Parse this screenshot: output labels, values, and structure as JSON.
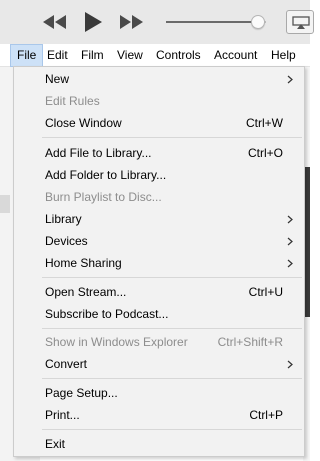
{
  "player": {
    "icons": [
      "rewind-icon",
      "play-icon",
      "fast-forward-icon",
      "airplay-icon"
    ],
    "volume_level": 0.92
  },
  "menubar": {
    "items": [
      "File",
      "Edit",
      "Film",
      "View",
      "Controls",
      "Account",
      "Help"
    ],
    "active": "File"
  },
  "file_menu": {
    "items": [
      {
        "label": "New",
        "submenu": true
      },
      {
        "label": "Edit Rules",
        "disabled": true
      },
      {
        "label": "Close Window",
        "shortcut": "Ctrl+W"
      },
      {
        "label": "Add File to Library...",
        "shortcut": "Ctrl+O"
      },
      {
        "label": "Add Folder to Library..."
      },
      {
        "label": "Burn Playlist to Disc...",
        "disabled": true
      },
      {
        "label": "Library",
        "submenu": true
      },
      {
        "label": "Devices",
        "submenu": true
      },
      {
        "label": "Home Sharing",
        "submenu": true
      },
      {
        "label": "Open Stream...",
        "shortcut": "Ctrl+U"
      },
      {
        "label": "Subscribe to Podcast..."
      },
      {
        "label": "Show in Windows Explorer",
        "shortcut": "Ctrl+Shift+R",
        "disabled": true
      },
      {
        "label": "Convert",
        "submenu": true
      },
      {
        "label": "Page Setup..."
      },
      {
        "label": "Print...",
        "shortcut": "Ctrl+P"
      },
      {
        "label": "Exit"
      }
    ]
  },
  "colors": {
    "menu_background": "#f2f2f2",
    "active_menubar": "#cde1f7",
    "disabled_text": "#8d8d8d"
  }
}
